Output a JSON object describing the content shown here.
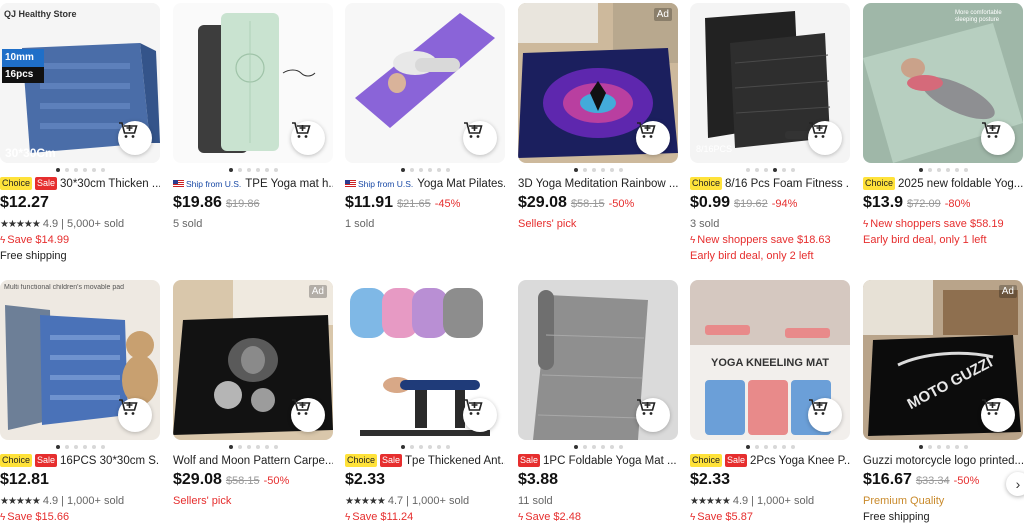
{
  "products": [
    {
      "title": "30*30cm Thicken ...",
      "badges": [
        "Choice",
        "Sale"
      ],
      "ship": "",
      "price": "$12.27",
      "original": "",
      "discount": "",
      "rating": "4.9",
      "sold": "5,000+ sold",
      "save": "Save $14.99",
      "promo1": "",
      "promo2": "",
      "footer": "Free shipping",
      "footer_style": "plain",
      "img_text_1": "QJ Healthy Store",
      "img_text_2": "10mm",
      "img_text_3": "16pcs",
      "img_text_4": "30*30Cm",
      "ad": ""
    },
    {
      "title": "TPE Yoga mat h...",
      "badges": [],
      "ship": "Ship from U.S.",
      "price": "$19.86",
      "original": "$19.86",
      "discount": "",
      "rating": "",
      "sold": "5 sold",
      "save": "",
      "promo1": "",
      "promo2": "",
      "footer": "",
      "footer_style": "plain",
      "ad": ""
    },
    {
      "title": "Yoga Mat Pilates...",
      "badges": [],
      "ship": "Ship from U.S.",
      "price": "$11.91",
      "original": "$21.65",
      "discount": "-45%",
      "rating": "",
      "sold": "1 sold",
      "save": "",
      "promo1": "",
      "promo2": "",
      "footer": "",
      "footer_style": "plain",
      "ad": ""
    },
    {
      "title": "3D Yoga Meditation Rainbow ...",
      "badges": [],
      "ship": "",
      "price": "$29.08",
      "original": "$58.15",
      "discount": "-50%",
      "rating": "",
      "sold": "",
      "save": "",
      "promo1": "",
      "promo2": "",
      "footer": "Sellers' pick",
      "footer_style": "red",
      "ad": "Ad"
    },
    {
      "title": "8/16 Pcs Foam Fitness ...",
      "badges": [
        "Choice"
      ],
      "ship": "",
      "price": "$0.99",
      "original": "$19.62",
      "discount": "-94%",
      "rating": "",
      "sold": "3 sold",
      "save": "",
      "promo1": "New shoppers save $18.63",
      "promo2": "Early bird deal, only 2 left",
      "footer": "",
      "footer_style": "plain",
      "img_text_1": "8/16PCS",
      "ad": ""
    },
    {
      "title": "2025 new foldable Yog...",
      "badges": [
        "Choice"
      ],
      "ship": "",
      "price": "$13.9",
      "original": "$72.09",
      "discount": "-80%",
      "rating": "",
      "sold": "",
      "save": "",
      "promo1": "New shoppers save $58.19",
      "promo2": "Early bird deal, only 1 left",
      "footer": "",
      "footer_style": "plain",
      "img_text_1": "More comfortable sleeping posture",
      "ad": ""
    },
    {
      "title": "16PCS 30*30cm S...",
      "badges": [
        "Choice",
        "Sale"
      ],
      "ship": "",
      "price": "$12.81",
      "original": "",
      "discount": "",
      "rating": "4.9",
      "sold": "1,000+ sold",
      "save": "Save $15.66",
      "promo1": "",
      "promo2": "",
      "footer": "",
      "footer_style": "plain",
      "img_text_1": "Multi functional children's movable pad",
      "ad": ""
    },
    {
      "title": "Wolf and Moon Pattern Carpe...",
      "badges": [],
      "ship": "",
      "price": "$29.08",
      "original": "$58.15",
      "discount": "-50%",
      "rating": "",
      "sold": "",
      "save": "",
      "promo1": "",
      "promo2": "",
      "footer": "Sellers' pick",
      "footer_style": "red",
      "ad": "Ad"
    },
    {
      "title": "Tpe Thickened Ant...",
      "badges": [
        "Choice",
        "Sale"
      ],
      "ship": "",
      "price": "$2.33",
      "original": "",
      "discount": "",
      "rating": "4.7",
      "sold": "1,000+ sold",
      "save": "Save $11.24",
      "promo1": "",
      "promo2": "",
      "footer": "",
      "footer_style": "plain",
      "ad": ""
    },
    {
      "title": "1PC Foldable Yoga Mat ...",
      "badges": [
        "Sale"
      ],
      "ship": "",
      "price": "$3.88",
      "original": "",
      "discount": "",
      "rating": "",
      "sold": "11 sold",
      "save": "Save $2.48",
      "promo1": "",
      "promo2": "",
      "footer": "",
      "footer_style": "plain",
      "ad": ""
    },
    {
      "title": "2Pcs Yoga Knee P...",
      "badges": [
        "Choice",
        "Sale"
      ],
      "ship": "",
      "price": "$2.33",
      "original": "",
      "discount": "",
      "rating": "4.9",
      "sold": "1,000+ sold",
      "save": "Save $5.87",
      "promo1": "",
      "promo2": "",
      "footer": "",
      "footer_style": "plain",
      "img_text_1": "YOGA KNEELING MAT",
      "ad": ""
    },
    {
      "title": "Guzzi motorcycle logo printed...",
      "badges": [],
      "ship": "",
      "price": "$16.67",
      "original": "$33.34",
      "discount": "-50%",
      "rating": "",
      "sold": "",
      "save": "",
      "promo1": "",
      "promo2": "",
      "footer": "Premium Quality",
      "footer_style": "gold",
      "footer2": "Free shipping",
      "img_text_1": "MOTO GUZZI",
      "ad": "Ad"
    }
  ],
  "colors": {
    "accent_red": "#e62e2e",
    "choice_yellow": "#ffe23a",
    "gold": "#c98a2b"
  },
  "icons": {
    "cart": "add-to-cart-icon",
    "next": "chevron-right-icon"
  }
}
